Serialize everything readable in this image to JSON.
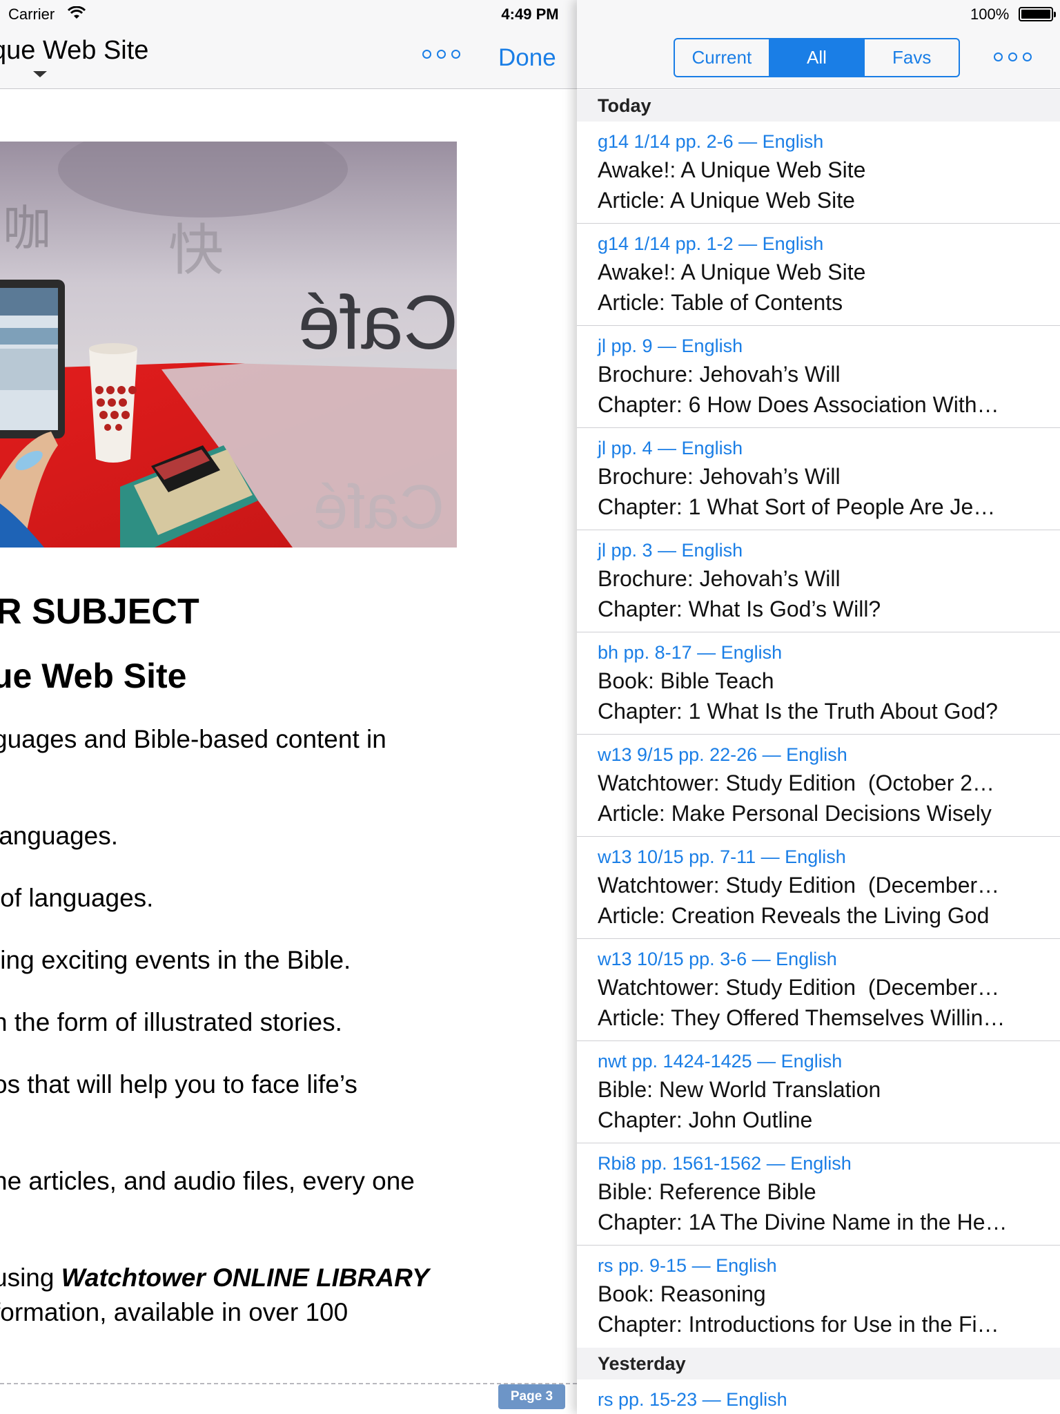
{
  "status_bar": {
    "carrier": "Carrier",
    "time": "4:49 PM",
    "battery": "100%"
  },
  "reader": {
    "title": "que Web Site",
    "done_label": "Done",
    "heading_subject": "R SUBJECT",
    "heading_title": "ue Web Site",
    "lines": [
      "guages and Bible-based content in",
      "languages.",
      " of languages.",
      "ting exciting events in the Bible.",
      "n the form of illustrated stories.",
      "os that will help you to face life’s",
      "ne articles, and audio files, every one",
      "formation, available in over 100"
    ],
    "library_line_pre": "using ",
    "library_line_em": "Watchtower ONLINE LIBRARY",
    "page_label": "Page 3",
    "hero_image": "cafe-tablet-photo"
  },
  "history": {
    "segments": [
      "Current",
      "All",
      "Favs"
    ],
    "active_segment": "All",
    "sections": [
      {
        "header": "Today",
        "items": [
          {
            "ref": "g14 1/14 pp. 2-6 — English",
            "line1": "Awake!: A Unique Web Site",
            "line2": "Article: A Unique Web Site"
          },
          {
            "ref": "g14 1/14 pp. 1-2 — English",
            "line1": "Awake!: A Unique Web Site",
            "line2": "Article: Table of Contents"
          },
          {
            "ref": "jl pp. 9 — English",
            "line1": "Brochure: Jehovah’s Will",
            "line2": "Chapter: 6 How Does Association With…"
          },
          {
            "ref": "jl pp. 4 — English",
            "line1": "Brochure: Jehovah’s Will",
            "line2": "Chapter: 1 What Sort of People Are Je…"
          },
          {
            "ref": "jl pp. 3 — English",
            "line1": "Brochure: Jehovah’s Will",
            "line2": "Chapter: What Is God’s Will?"
          },
          {
            "ref": "bh pp. 8-17 — English",
            "line1": "Book: Bible Teach",
            "line2": "Chapter: 1 What Is the Truth About God?"
          },
          {
            "ref": "w13 9/15 pp. 22-26 — English",
            "line1": "Watchtower: Study Edition  (October 2…",
            "line2": "Article: Make Personal Decisions Wisely"
          },
          {
            "ref": "w13 10/15 pp. 7-11 — English",
            "line1": "Watchtower: Study Edition  (December…",
            "line2": "Article: Creation Reveals the Living God"
          },
          {
            "ref": "w13 10/15 pp. 3-6 — English",
            "line1": "Watchtower: Study Edition  (December…",
            "line2": "Article: They Offered Themselves Willin…"
          },
          {
            "ref": "nwt pp. 1424-1425 — English",
            "line1": "Bible: New World Translation",
            "line2": "Chapter: John Outline"
          },
          {
            "ref": "Rbi8 pp. 1561-1562 — English",
            "line1": "Bible: Reference Bible",
            "line2": "Chapter: 1A The Divine Name in the He…"
          },
          {
            "ref": "rs pp. 9-15 — English",
            "line1": "Book: Reasoning",
            "line2": "Chapter: Introductions for Use in the Fi…"
          }
        ]
      },
      {
        "header": "Yesterday",
        "items": [
          {
            "ref": "rs pp. 15-23 — English"
          }
        ]
      }
    ]
  },
  "colors": {
    "accent": "#1a7ee6",
    "page_badge": "#6d95c7",
    "nav_bg": "#f7f7f8",
    "section_bg": "#f2f2f4"
  },
  "icons": {
    "more": "more-dots-icon",
    "wifi": "wifi-icon",
    "battery": "battery-icon",
    "caret": "caret-down-icon"
  }
}
